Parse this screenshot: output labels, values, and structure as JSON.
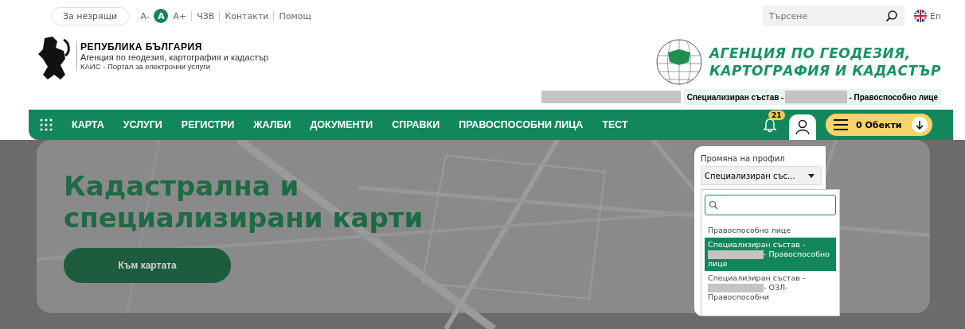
{
  "top_bar": {
    "accessibility_button": "За незрящи",
    "font_sizes": [
      {
        "label": "A-",
        "selected": false
      },
      {
        "label": "A",
        "selected": true
      },
      {
        "label": "A+",
        "selected": false
      }
    ],
    "links": [
      "ЧЗВ",
      "Контакти",
      "Помощ"
    ],
    "search": {
      "placeholder": "Търсене"
    },
    "language": "En"
  },
  "branding": {
    "title": "РЕПУБЛИКА БЪЛГАРИЯ",
    "subtitle": "Агенция по геодезия, картография и кадастър",
    "portal": "КАИС - Портал за електронни услуги",
    "agency_lines": [
      "АГЕНЦИЯ ПО ГЕОДЕЗИЯ,",
      "КАРТОГРАФИЯ И КАДАСТЪР"
    ]
  },
  "user_strip": {
    "prefix": "Специализиран състав -",
    "suffix": "- Правоспособно лице"
  },
  "nav": {
    "items": [
      "КАРТА",
      "УСЛУГИ",
      "РЕГИСТРИ",
      "ЖАЛБИ",
      "ДОКУМЕНТИ",
      "СПРАВКИ",
      "ПРАВОСПОСОБНИ ЛИЦА",
      "ТЕСТ"
    ],
    "notifications": "21",
    "cart": "0 Обекти"
  },
  "hero": {
    "title_lines": [
      "Кадастрална и",
      "специализирани карти"
    ],
    "button": "Към картата"
  },
  "profile_popup": {
    "label": "Промяна на профил",
    "select_value": "Специализиран със...",
    "options": [
      {
        "before": "Правоспособно лице",
        "redacted": false,
        "selected": false
      },
      {
        "before": "Специализиран състав -",
        "redacted": true,
        "after": "- Правоспособно лице",
        "selected": true
      },
      {
        "before": "Специализиран състав -",
        "redacted": true,
        "after": "- ОЗЛ-Правоспособни",
        "selected": false
      }
    ]
  }
}
